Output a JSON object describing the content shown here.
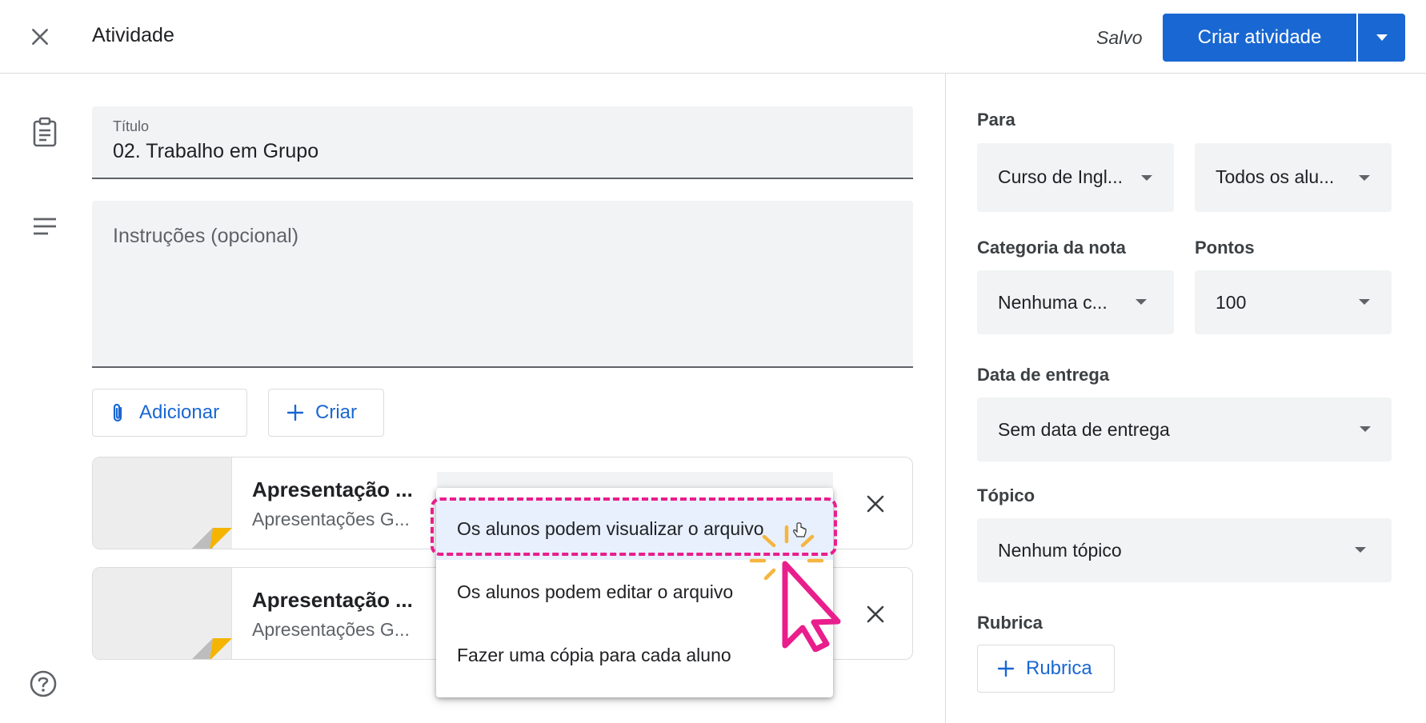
{
  "header": {
    "title": "Atividade",
    "saved_label": "Salvo",
    "create_label": "Criar atividade"
  },
  "form": {
    "title_label": "Título",
    "title_value": "02. Trabalho em Grupo",
    "instructions_placeholder": "Instruções (opcional)",
    "add_label": "Adicionar",
    "create_label": "Criar"
  },
  "attachments": [
    {
      "title": "Apresentação ...",
      "subtitle": "Apresentações G..."
    },
    {
      "title": "Apresentação ...",
      "subtitle": "Apresentações G..."
    }
  ],
  "share_menu": {
    "options": [
      "Os alunos podem visualizar o arquivo",
      "Os alunos podem editar o arquivo",
      "Fazer uma cópia para cada aluno"
    ],
    "selected_index": 0
  },
  "sidebar": {
    "for_label": "Para",
    "course_value": "Curso de Ingl...",
    "students_value": "Todos os alu...",
    "grade_category_label": "Categoria da nota",
    "grade_category_value": "Nenhuma c...",
    "points_label": "Pontos",
    "points_value": "100",
    "due_label": "Data de entrega",
    "due_value": "Sem data de entrega",
    "topic_label": "Tópico",
    "topic_value": "Nenhum tópico",
    "rubric_label": "Rubrica",
    "rubric_button": "Rubrica"
  },
  "colors": {
    "primary": "#1967d2",
    "highlight": "#e91e8c",
    "sparkle": "#f6b53f",
    "slides_yellow": "#f4b400"
  }
}
